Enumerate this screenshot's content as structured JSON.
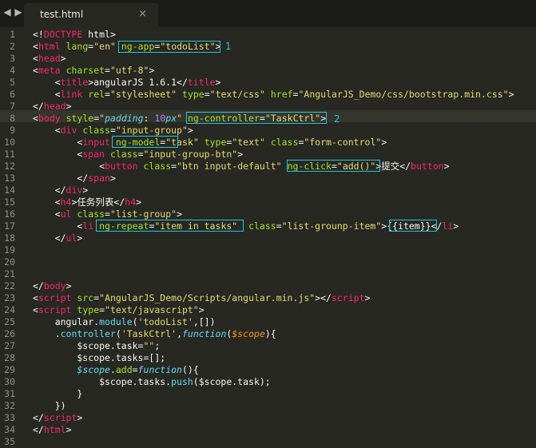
{
  "tab": {
    "title": "test.html",
    "close": "×",
    "back": "◀",
    "forward": "▶"
  },
  "annotations": {
    "one": "1",
    "two": "2"
  },
  "lines": [
    [
      [
        "t-plain",
        "<!"
      ],
      [
        "t-tag",
        "DOCTYPE"
      ],
      [
        "t-plain",
        " html>"
      ]
    ],
    [
      [
        "t-plain",
        "<"
      ],
      [
        "t-tag",
        "html"
      ],
      [
        "t-plain",
        " "
      ],
      [
        "t-attr",
        "lang"
      ],
      [
        "t-plain",
        "="
      ],
      [
        "t-str",
        "\"en\""
      ],
      [
        "t-plain",
        " "
      ],
      [
        "t-attr",
        "ng-app"
      ],
      [
        "t-plain",
        "="
      ],
      [
        "t-str",
        "\"todoList\""
      ],
      [
        "t-plain",
        ">"
      ]
    ],
    [
      [
        "t-plain",
        "<"
      ],
      [
        "t-tag",
        "head"
      ],
      [
        "t-plain",
        ">"
      ]
    ],
    [
      [
        "t-plain",
        "<"
      ],
      [
        "t-tag",
        "meta"
      ],
      [
        "t-plain",
        " "
      ],
      [
        "t-attr",
        "charset"
      ],
      [
        "t-plain",
        "="
      ],
      [
        "t-str",
        "\"utf-8\""
      ],
      [
        "t-plain",
        ">"
      ]
    ],
    [
      [
        "t-plain",
        "    <"
      ],
      [
        "t-tag",
        "title"
      ],
      [
        "t-plain",
        ">angularJS 1.6.1</"
      ],
      [
        "t-tag",
        "title"
      ],
      [
        "t-plain",
        ">"
      ]
    ],
    [
      [
        "t-plain",
        "    <"
      ],
      [
        "t-tag",
        "link"
      ],
      [
        "t-plain",
        " "
      ],
      [
        "t-attr",
        "rel"
      ],
      [
        "t-plain",
        "="
      ],
      [
        "t-str",
        "\"stylesheet\""
      ],
      [
        "t-plain",
        " "
      ],
      [
        "t-attr",
        "type"
      ],
      [
        "t-plain",
        "="
      ],
      [
        "t-str",
        "\"text/css\""
      ],
      [
        "t-plain",
        " "
      ],
      [
        "t-attr",
        "href"
      ],
      [
        "t-plain",
        "="
      ],
      [
        "t-str",
        "\"AngularJS_Demo/css/bootstrap.min.css\""
      ],
      [
        "t-plain",
        ">"
      ]
    ],
    [
      [
        "t-plain",
        "</"
      ],
      [
        "t-tag",
        "head"
      ],
      [
        "t-plain",
        ">"
      ]
    ],
    [
      [
        "t-plain",
        "<"
      ],
      [
        "t-tag",
        "body"
      ],
      [
        "t-plain",
        " "
      ],
      [
        "t-attr",
        "style"
      ],
      [
        "t-plain",
        "="
      ],
      [
        "t-str",
        "\""
      ],
      [
        "t-cssprop",
        "padding"
      ],
      [
        "t-plain",
        ": "
      ],
      [
        "t-num",
        "10"
      ],
      [
        "t-kw",
        "px"
      ],
      [
        "t-str",
        "\""
      ],
      [
        "t-plain",
        " "
      ],
      [
        "t-attr",
        "ng-controller"
      ],
      [
        "t-plain",
        "="
      ],
      [
        "t-str",
        "\"TaskCtrl\""
      ],
      [
        "t-plain",
        ">"
      ]
    ],
    [
      [
        "t-plain",
        "    <"
      ],
      [
        "t-tag",
        "div"
      ],
      [
        "t-plain",
        " "
      ],
      [
        "t-attr",
        "class"
      ],
      [
        "t-plain",
        "="
      ],
      [
        "t-str",
        "\"input-group\""
      ],
      [
        "t-plain",
        ">"
      ]
    ],
    [
      [
        "t-plain",
        "        <"
      ],
      [
        "t-tag",
        "input"
      ],
      [
        "t-plain",
        " "
      ],
      [
        "t-attr",
        "ng-model"
      ],
      [
        "t-plain",
        "="
      ],
      [
        "t-str",
        "\"task\""
      ],
      [
        "t-plain",
        " "
      ],
      [
        "t-attr",
        "type"
      ],
      [
        "t-plain",
        "="
      ],
      [
        "t-str",
        "\"text\""
      ],
      [
        "t-plain",
        " "
      ],
      [
        "t-attr",
        "class"
      ],
      [
        "t-plain",
        "="
      ],
      [
        "t-str",
        "\"form-control\""
      ],
      [
        "t-plain",
        ">"
      ]
    ],
    [
      [
        "t-plain",
        "        <"
      ],
      [
        "t-tag",
        "span"
      ],
      [
        "t-plain",
        " "
      ],
      [
        "t-attr",
        "class"
      ],
      [
        "t-plain",
        "="
      ],
      [
        "t-str",
        "\"input-group-btn\""
      ],
      [
        "t-plain",
        ">"
      ]
    ],
    [
      [
        "t-plain",
        "            <"
      ],
      [
        "t-tag",
        "button"
      ],
      [
        "t-plain",
        " "
      ],
      [
        "t-attr",
        "class"
      ],
      [
        "t-plain",
        "="
      ],
      [
        "t-str",
        "\"btn input-default\""
      ],
      [
        "t-plain",
        " "
      ],
      [
        "t-attr",
        "ng-click"
      ],
      [
        "t-plain",
        "="
      ],
      [
        "t-str",
        "\"add()\""
      ],
      [
        "t-plain",
        ">"
      ],
      [
        "t-plain t-cjk",
        "提交"
      ],
      [
        "t-plain",
        "</"
      ],
      [
        "t-tag",
        "button"
      ],
      [
        "t-plain",
        ">"
      ]
    ],
    [
      [
        "t-plain",
        "        </"
      ],
      [
        "t-tag",
        "span"
      ],
      [
        "t-plain",
        ">"
      ]
    ],
    [
      [
        "t-plain",
        "    </"
      ],
      [
        "t-tag",
        "div"
      ],
      [
        "t-plain",
        ">"
      ]
    ],
    [
      [
        "t-plain",
        "    <"
      ],
      [
        "t-tag",
        "h4"
      ],
      [
        "t-plain",
        ">"
      ],
      [
        "t-plain t-cjk",
        "任务列表"
      ],
      [
        "t-plain",
        "</"
      ],
      [
        "t-tag",
        "h4"
      ],
      [
        "t-plain",
        ">"
      ]
    ],
    [
      [
        "t-plain",
        "    <"
      ],
      [
        "t-tag",
        "ul"
      ],
      [
        "t-plain",
        " "
      ],
      [
        "t-attr",
        "class"
      ],
      [
        "t-plain",
        "="
      ],
      [
        "t-str",
        "\"list-group\""
      ],
      [
        "t-plain",
        ">"
      ]
    ],
    [
      [
        "t-plain",
        "        <"
      ],
      [
        "t-tag",
        "li"
      ],
      [
        "t-plain",
        " "
      ],
      [
        "t-attr",
        "ng-repeat"
      ],
      [
        "t-plain",
        "="
      ],
      [
        "t-str",
        "\"item in tasks\""
      ],
      [
        "t-plain",
        "  "
      ],
      [
        "t-attr",
        "class"
      ],
      [
        "t-plain",
        "="
      ],
      [
        "t-str",
        "\"list-grounp-item\""
      ],
      [
        "t-plain",
        ">{{item}}</"
      ],
      [
        "t-tag",
        "li"
      ],
      [
        "t-plain",
        ">"
      ]
    ],
    [
      [
        "t-plain",
        "    </"
      ],
      [
        "t-tag",
        "ul"
      ],
      [
        "t-plain",
        ">"
      ]
    ],
    [],
    [],
    [],
    [
      [
        "t-plain",
        "</"
      ],
      [
        "t-tag",
        "body"
      ],
      [
        "t-plain",
        ">"
      ]
    ],
    [
      [
        "t-plain",
        "<"
      ],
      [
        "t-tag",
        "script"
      ],
      [
        "t-plain",
        " "
      ],
      [
        "t-attr",
        "src"
      ],
      [
        "t-plain",
        "="
      ],
      [
        "t-str",
        "\"AngularJS_Demo/Scripts/angular.min.js\""
      ],
      [
        "t-plain",
        "></"
      ],
      [
        "t-tag",
        "script"
      ],
      [
        "t-plain",
        ">"
      ]
    ],
    [
      [
        "t-plain",
        "<"
      ],
      [
        "t-tag",
        "script"
      ],
      [
        "t-plain",
        " "
      ],
      [
        "t-attr",
        "type"
      ],
      [
        "t-plain",
        "="
      ],
      [
        "t-str",
        "\"text/javascript\""
      ],
      [
        "t-plain",
        ">"
      ]
    ],
    [
      [
        "t-plain",
        "    angular."
      ],
      [
        "t-fn",
        "module"
      ],
      [
        "t-plain",
        "("
      ],
      [
        "t-str",
        "'todoList'"
      ],
      [
        "t-plain",
        ",[])"
      ]
    ],
    [
      [
        "t-plain",
        "    ."
      ],
      [
        "t-fn",
        "controller"
      ],
      [
        "t-plain",
        "("
      ],
      [
        "t-str",
        "'TaskCtrl'"
      ],
      [
        "t-plain",
        ","
      ],
      [
        "t-kw",
        "function"
      ],
      [
        "t-plain",
        "("
      ],
      [
        "t-param",
        "$scope"
      ],
      [
        "t-plain",
        "){"
      ]
    ],
    [
      [
        "t-plain",
        "        $scope.task="
      ],
      [
        "t-str",
        "\"\""
      ],
      [
        "t-plain",
        ";"
      ]
    ],
    [
      [
        "t-plain",
        "        $scope.tasks=[];"
      ]
    ],
    [
      [
        "t-plain",
        "        "
      ],
      [
        "t-kw",
        "$scope"
      ],
      [
        "t-plain",
        "."
      ],
      [
        "t-attr",
        "add"
      ],
      [
        "t-plain",
        "="
      ],
      [
        "t-kw",
        "function"
      ],
      [
        "t-plain",
        "(){"
      ]
    ],
    [
      [
        "t-plain",
        "            $scope.tasks."
      ],
      [
        "t-fn",
        "push"
      ],
      [
        "t-plain",
        "($scope.task);"
      ]
    ],
    [
      [
        "t-plain",
        "        }"
      ]
    ],
    [
      [
        "t-plain",
        "    })"
      ]
    ],
    [
      [
        "t-plain",
        "</"
      ],
      [
        "t-tag",
        "script"
      ],
      [
        "t-plain",
        ">"
      ]
    ],
    [
      [
        "t-plain",
        "</"
      ],
      [
        "t-tag",
        "html"
      ],
      [
        "t-plain",
        ">"
      ]
    ],
    []
  ]
}
